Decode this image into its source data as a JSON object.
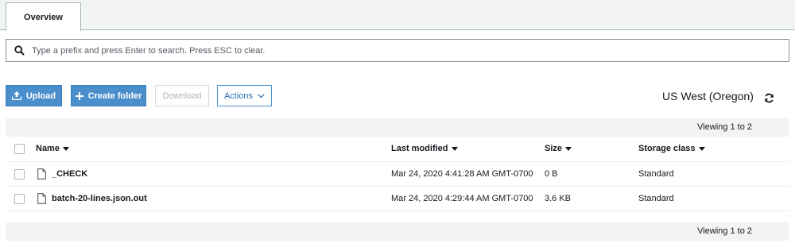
{
  "tabs": [
    {
      "label": "Overview"
    }
  ],
  "search": {
    "placeholder": "Type a prefix and press Enter to search. Press ESC to clear.",
    "value": ""
  },
  "toolbar": {
    "upload_label": "Upload",
    "create_folder_label": "Create folder",
    "download_label": "Download",
    "actions_label": "Actions",
    "region": "US West (Oregon)"
  },
  "pagination": {
    "top_text": "Viewing 1 to 2",
    "bottom_text": "Viewing 1 to 2"
  },
  "table": {
    "columns": {
      "name": "Name",
      "last_modified": "Last modified",
      "size": "Size",
      "storage_class": "Storage class"
    },
    "rows": [
      {
        "name": "_CHECK",
        "last_modified": "Mar 24, 2020 4:41:28 AM GMT-0700",
        "size": "0 B",
        "storage_class": "Standard"
      },
      {
        "name": "batch-20-lines.json.out",
        "last_modified": "Mar 24, 2020 4:29:44 AM GMT-0700",
        "size": "3.6 KB",
        "storage_class": "Standard"
      }
    ]
  },
  "icons": {
    "search": "search-icon",
    "upload": "upload-icon",
    "create_folder": "plus-icon",
    "actions": "chevron-down-icon",
    "refresh": "refresh-icon",
    "file": "file-icon"
  },
  "colors": {
    "primary": "#4a8fcc",
    "tab_bar": "#f2f3f3",
    "pager": "#f2f3f3"
  }
}
